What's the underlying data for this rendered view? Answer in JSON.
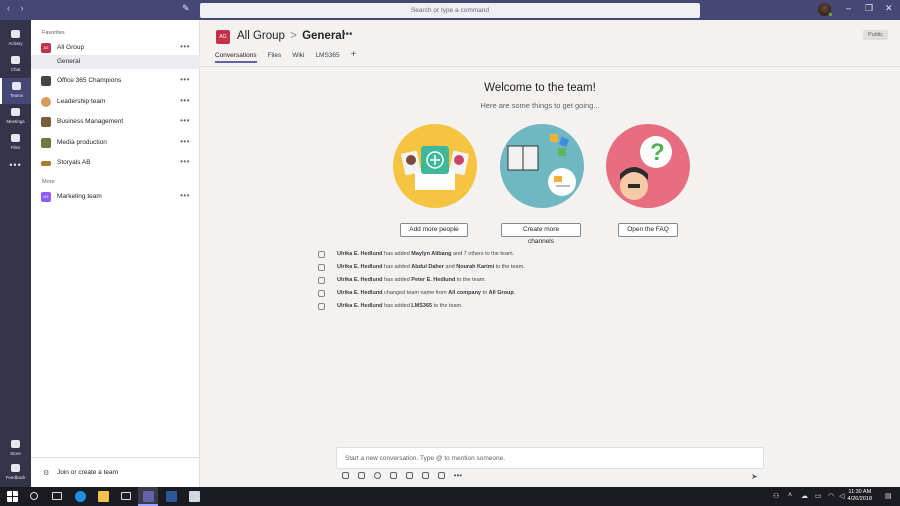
{
  "titlebar": {
    "search_placeholder": "Search or type a command",
    "back_icon": "‹",
    "forward_icon": "›",
    "compose_icon": "✎",
    "minimize": "–",
    "restore": "❐",
    "close": "✕"
  },
  "rail": {
    "items": [
      {
        "label": "Activity"
      },
      {
        "label": "Chat"
      },
      {
        "label": "Teams"
      },
      {
        "label": "Meetings"
      },
      {
        "label": "Files"
      }
    ],
    "more": "•••",
    "store": "Store",
    "feedback": "Feedback"
  },
  "teams": {
    "favorites_label": "Favorites",
    "more_label": "More",
    "favorites": [
      {
        "name": "All Group",
        "avatar_text": "AG",
        "color": "#c4314b"
      },
      {
        "name": "Office 365 Champions",
        "color": "#444444"
      },
      {
        "name": "Leadership team",
        "color": "#d79a5b"
      },
      {
        "name": "Business Management",
        "color": "#7a5c3e"
      },
      {
        "name": "Media production",
        "color": "#6b7a3e"
      },
      {
        "name": "Storyals AB",
        "color": "#b07a2a"
      }
    ],
    "active_channel": "General",
    "more_teams": [
      {
        "name": "Marketing team",
        "avatar_text": "MT",
        "color": "#8e5ef0"
      }
    ],
    "row_more": "•••",
    "join_label": "Join or create a team"
  },
  "header": {
    "avatar_text": "AG",
    "team": "All Group",
    "separator": ">",
    "channel": "General",
    "more": "•••",
    "visibility": "Public",
    "tabs": [
      "Conversations",
      "Files",
      "Wiki",
      "LMS365"
    ],
    "add_tab": "+"
  },
  "welcome": {
    "title": "Welcome to the team!",
    "subtitle": "Here are some things to get going...",
    "buttons": [
      "Add more people",
      "Create more channels",
      "Open the FAQ"
    ]
  },
  "activity": [
    {
      "actor": "Ulrika E. Hedlund",
      "text1": " has added ",
      "b1": "Maylyn Alibang",
      "text2": " and 7 others to the team."
    },
    {
      "actor": "Ulrika E. Hedlund",
      "text1": " has added ",
      "b1": "Abdul Daher",
      "text2": " and ",
      "b2": "Nourah Karimi",
      "text3": " to the team."
    },
    {
      "actor": "Ulrika E. Hedlund",
      "text1": " has added ",
      "b1": "Peter E. Hedlund",
      "text2": " to the team."
    },
    {
      "actor": "Ulrika E. Hedlund",
      "text1": " changed team name from ",
      "b1": "All company",
      "text2": " to ",
      "b2": "All Group",
      "text3": "."
    },
    {
      "actor": "Ulrika E. Hedlund",
      "text1": " has added ",
      "b1": "LMS365",
      "text2": " to the team."
    }
  ],
  "composer": {
    "placeholder": "Start a new conversation. Type @ to mention someone.",
    "more": "•••",
    "send": "➤"
  },
  "taskbar": {
    "time": "11:30 AM",
    "date": "4/26/2018"
  },
  "colors": {
    "brand": "#464775",
    "rail": "#33344a",
    "accent": "#6264a7"
  }
}
